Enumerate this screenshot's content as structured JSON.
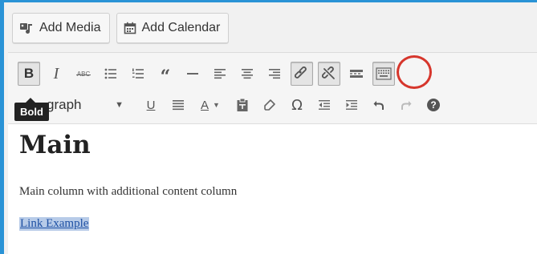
{
  "media_buttons": {
    "add_media_label": "Add Media",
    "add_calendar_label": "Add Calendar"
  },
  "toolbar": {
    "row1": [
      {
        "name": "bold-button",
        "glyph": "B"
      },
      {
        "name": "italic-button",
        "glyph": "I"
      },
      {
        "name": "strikethrough-button",
        "glyph": "ABC"
      },
      {
        "name": "bulleted-list-button"
      },
      {
        "name": "numbered-list-button"
      },
      {
        "name": "blockquote-button",
        "glyph": "66"
      },
      {
        "name": "horizontal-line-button"
      },
      {
        "name": "align-left-button"
      },
      {
        "name": "align-center-button"
      },
      {
        "name": "align-right-button"
      },
      {
        "name": "insert-link-button"
      },
      {
        "name": "remove-link-button"
      },
      {
        "name": "read-more-button"
      },
      {
        "name": "toolbar-toggle-button"
      }
    ],
    "row2": {
      "format_select_value": "Paragraph",
      "format_select_visible": "graph",
      "buttons": [
        "underline-button",
        "justify-button",
        "text-color-button",
        "paste-as-text-button",
        "clear-formatting-button",
        "special-character-button",
        "decrease-indent-button",
        "increase-indent-button",
        "undo-button",
        "redo-button",
        "keyboard-shortcuts-button"
      ]
    },
    "tooltip": "Bold"
  },
  "content": {
    "heading": "Main",
    "paragraph": "Main column with additional content column",
    "link_text": "Link Example"
  },
  "colors": {
    "frame_border": "#2a93d6",
    "highlight_ring": "#d6362c",
    "link": "#1c4fa3",
    "selection": "#b7cbe8"
  }
}
